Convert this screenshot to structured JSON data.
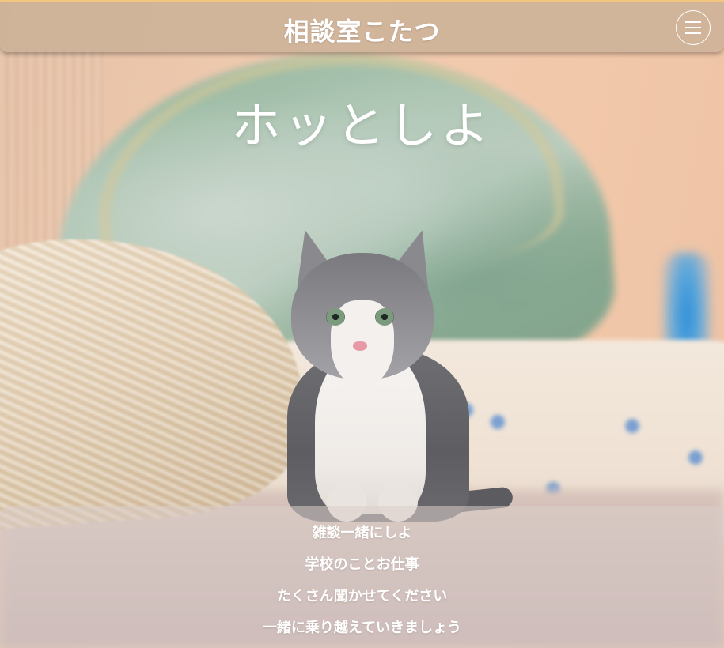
{
  "header": {
    "site_title": "相談室こたつ",
    "menu_icon": "hamburger-menu-icon"
  },
  "hero": {
    "title": "ホッとしよ"
  },
  "message": {
    "lines": [
      "雑談一緒にしよ",
      "学校のことお仕事",
      "たくさん聞かせてください",
      "一緒に乗り越えていきましょう"
    ]
  },
  "colors": {
    "header_background": "#c8af96",
    "header_top_border": "#f2c67e",
    "text": "#ffffff",
    "wall": "#f0cbb0"
  }
}
